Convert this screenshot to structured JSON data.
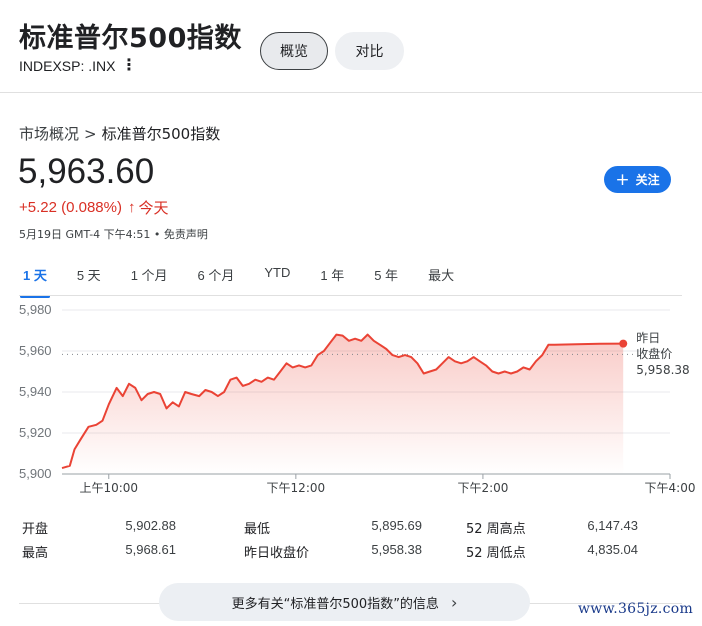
{
  "header": {
    "title": "标准普尔500指数",
    "ticker": "INDEXSP: .INX",
    "kebab": "⋮",
    "tabs": [
      {
        "label": "概览"
      },
      {
        "label": "对比"
      }
    ]
  },
  "breadcrumb": {
    "parent": "市场概况",
    "separator": ">",
    "current": "标准普尔500指数"
  },
  "quote": {
    "price": "5,963.60",
    "change": "+5.22 (0.088%)",
    "arrow": "↑",
    "period": "今天",
    "meta": "5月19日 GMT-4 下午4:51 • 免责声明"
  },
  "follow_button": {
    "label": "关注",
    "icon": "+"
  },
  "ranges": [
    "1 天",
    "5 天",
    "1 个月",
    "6 个月",
    "YTD",
    "1 年",
    "5 年",
    "最大"
  ],
  "chart_data": {
    "type": "line",
    "y_ticks": [
      "5,980",
      "5,960",
      "5,940",
      "5,920",
      "5,900"
    ],
    "ylim": [
      5900,
      5980
    ],
    "x_ticks": [
      {
        "label": "上午10:00",
        "t": 30
      },
      {
        "label": "下午12:00",
        "t": 150
      },
      {
        "label": "下午2:00",
        "t": 270
      },
      {
        "label": "下午4:00",
        "t": 390
      }
    ],
    "x_range": [
      0,
      390
    ],
    "previous_close": {
      "label_line1": "昨日",
      "label_line2": "收盘价",
      "value": 5958.38,
      "value_label": "5,958.38"
    },
    "series": [
      {
        "color": "#ea4335",
        "points": [
          [
            0,
            5902.9
          ],
          [
            5,
            5904
          ],
          [
            8,
            5912
          ],
          [
            12,
            5917
          ],
          [
            17,
            5923
          ],
          [
            22,
            5924
          ],
          [
            26,
            5926
          ],
          [
            30,
            5934
          ],
          [
            35,
            5942
          ],
          [
            39,
            5938
          ],
          [
            43,
            5944
          ],
          [
            47,
            5942
          ],
          [
            51,
            5936
          ],
          [
            55,
            5939
          ],
          [
            59,
            5940
          ],
          [
            63,
            5939
          ],
          [
            67,
            5932
          ],
          [
            71,
            5935
          ],
          [
            75,
            5933
          ],
          [
            79,
            5940
          ],
          [
            83,
            5939
          ],
          [
            88,
            5938
          ],
          [
            92,
            5941
          ],
          [
            96,
            5940
          ],
          [
            100,
            5938
          ],
          [
            104,
            5940
          ],
          [
            108,
            5946
          ],
          [
            112,
            5947
          ],
          [
            116,
            5943
          ],
          [
            120,
            5944
          ],
          [
            124,
            5946
          ],
          [
            128,
            5945
          ],
          [
            132,
            5947
          ],
          [
            136,
            5946
          ],
          [
            140,
            5950
          ],
          [
            144,
            5954
          ],
          [
            148,
            5952
          ],
          [
            152,
            5953
          ],
          [
            156,
            5952
          ],
          [
            160,
            5953
          ],
          [
            164,
            5958
          ],
          [
            168,
            5960
          ],
          [
            172,
            5964
          ],
          [
            176,
            5968
          ],
          [
            180,
            5967.5
          ],
          [
            184,
            5965
          ],
          [
            188,
            5966
          ],
          [
            192,
            5965
          ],
          [
            196,
            5968
          ],
          [
            200,
            5965
          ],
          [
            204,
            5963
          ],
          [
            208,
            5961
          ],
          [
            212,
            5958
          ],
          [
            216,
            5957
          ],
          [
            220,
            5958
          ],
          [
            224,
            5957
          ],
          [
            228,
            5954
          ],
          [
            232,
            5949
          ],
          [
            236,
            5950
          ],
          [
            240,
            5951
          ],
          [
            244,
            5954
          ],
          [
            248,
            5957
          ],
          [
            252,
            5955
          ],
          [
            256,
            5954
          ],
          [
            260,
            5955
          ],
          [
            264,
            5957
          ],
          [
            268,
            5955
          ],
          [
            272,
            5953
          ],
          [
            276,
            5950
          ],
          [
            280,
            5949
          ],
          [
            284,
            5950
          ],
          [
            288,
            5949
          ],
          [
            292,
            5950
          ],
          [
            296,
            5952
          ],
          [
            300,
            5951
          ],
          [
            304,
            5955
          ],
          [
            308,
            5958
          ],
          [
            312,
            5963
          ],
          [
            316,
            5963
          ],
          [
            330,
            5963.3
          ],
          [
            345,
            5963.5
          ],
          [
            360,
            5963.6
          ]
        ]
      }
    ],
    "last_point": [
      360,
      5963.6
    ]
  },
  "stats": [
    [
      {
        "label": "开盘",
        "value": "5,902.88"
      },
      {
        "label": "最低",
        "value": "5,895.69"
      },
      {
        "label": "52 周高点",
        "value": "6,147.43"
      }
    ],
    [
      {
        "label": "最高",
        "value": "5,968.61"
      },
      {
        "label": "昨日收盘价",
        "value": "5,958.38"
      },
      {
        "label": "52 周低点",
        "value": "4,835.04"
      }
    ]
  ],
  "more_button": {
    "label": "更多有关“标准普尔500指数”的信息",
    "icon": "chevron-right"
  },
  "watermark": "www.365jz.com"
}
